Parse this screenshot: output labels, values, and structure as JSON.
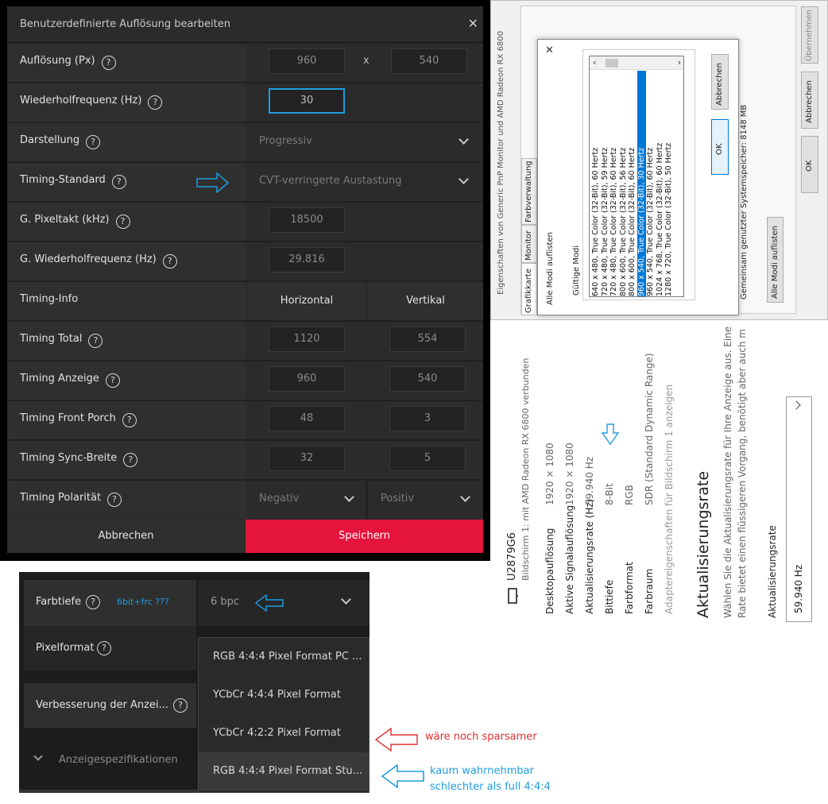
{
  "amd_dialog": {
    "title": "Benutzerdefinierte Auflösung bearbeiten",
    "close_glyph": "✕",
    "help_glyph": "?",
    "rows": {
      "resolution": {
        "label": "Auflösung (Px)",
        "width": "960",
        "sep": "x",
        "height": "540"
      },
      "refresh": {
        "label": "Wiederholfrequenz (Hz)",
        "value": "30"
      },
      "display_mode": {
        "label": "Darstellung",
        "value": "Progressiv"
      },
      "timing_standard": {
        "label": "Timing-Standard",
        "value": "CVT-verringerte Austastung"
      },
      "pixel_clock": {
        "label": "G. Pixeltakt (kHz)",
        "value": "18500"
      },
      "refresh_g": {
        "label": "G. Wiederholfrequenz (Hz)",
        "value": "29.816"
      },
      "timing_info": {
        "label": "Timing-Info",
        "horizontal": "Horizontal",
        "vertical": "Vertikal"
      },
      "timing_total": {
        "label": "Timing Total",
        "h": "1120",
        "v": "554"
      },
      "timing_display": {
        "label": "Timing Anzeige",
        "h": "960",
        "v": "540"
      },
      "front_porch": {
        "label": "Timing Front Porch",
        "h": "48",
        "v": "3"
      },
      "sync_width": {
        "label": "Timing Sync-Breite",
        "h": "32",
        "v": "5"
      },
      "polarity": {
        "label": "Timing Polarität",
        "h": "Negativ",
        "v": "Positiv"
      }
    },
    "cancel_label": "Abbrechen",
    "save_label": "Speichern",
    "accent": "#e5143c",
    "highlight": "#1e9de0"
  },
  "win_properties": {
    "title": "Eigenschaften von Generic PnP Monitor und AMD Radeon RX 6800",
    "tabs": [
      "Grafikkarte",
      "Monitor",
      "Farbverwaltung"
    ],
    "list_all_modes": "Alle Modi auflisten",
    "valid_modes": "Gültige Modi",
    "modes": [
      "640 x 480, True Color (32-Bit), 60 Hertz",
      "720 x 480, True Color (32-Bit), 59 Hertz",
      "720 x 480, True Color (32-Bit), 60 Hertz",
      "800 x 600, True Color (32-Bit), 56 Hertz",
      "800 x 600, True Color (32-Bit), 60 Hertz",
      "960 x 540, True Color (32-Bit), 30 Hertz",
      "960 x 540, True Color (32-Bit), 60 Hertz",
      "1024 x 768, True Color (32-Bit), 60 Hertz",
      "1280 x 720, True Color (32-Bit), 50 Hertz"
    ],
    "selected_mode_index": 5,
    "ok_label": "OK",
    "cancel_label": "Abbrechen",
    "apply_label": "Übernehmen",
    "shared_memory": "Gemeinsam genutzter Systemspeicher: 8148 MB",
    "all_modes_button": "Alle Modi auflisten",
    "close_glyph": "✕"
  },
  "display_settings": {
    "monitor_name": "U2879G6",
    "monitor_sub": "Bildschirm 1: mit AMD Radeon RX 6800 verbunden",
    "props": [
      {
        "label": "Desktopauflösung",
        "value": "1920 × 1080"
      },
      {
        "label": "Aktive Signalauflösung",
        "value": "1920 × 1080"
      },
      {
        "label": "Aktualisierungsrate (Hz)",
        "value": "59.940 Hz"
      },
      {
        "label": "Bittiefe",
        "value": "8-Bit"
      },
      {
        "label": "Farbformat",
        "value": "RGB"
      },
      {
        "label": "Farbraum",
        "value": "SDR (Standard Dynamic Range)"
      }
    ],
    "adapter_link": "Adaptereigenschaften für Bildschirm 1 anzeigen",
    "section_title": "Aktualisierungsrate",
    "desc1": "Wählen Sie die Aktualisierungsrate für Ihre Anzeige aus. Eine",
    "desc2": "Rate bietet einen flüssigeren Vorgang, benötigt aber auch m",
    "rate_label": "Aktualisierungsrate",
    "rate_value": "59.940 Hz"
  },
  "pixel_panel": {
    "color_depth_label": "Farbtiefe",
    "color_depth_note": "6bit+frc ???",
    "color_depth_value": "6 bpc",
    "pixel_format_label": "Pixelformat",
    "enhance_label": "Verbesserung der Anzei...",
    "specs_label": "Anzeigespezifikationen",
    "options": [
      "RGB 4:4:4 Pixel Format PC ...",
      "YCbCr 4:4:4 Pixel Format",
      "YCbCr 4:2:2 Pixel Format",
      "RGB 4:4:4 Pixel Format Stu..."
    ]
  },
  "annotations": {
    "red_note": "wäre noch sparsamer",
    "blue_note_1": "kaum wahrnehmbar",
    "blue_note_2": "schlechter als full 4:4:4",
    "red": "#e03030",
    "blue": "#1e9de0"
  }
}
